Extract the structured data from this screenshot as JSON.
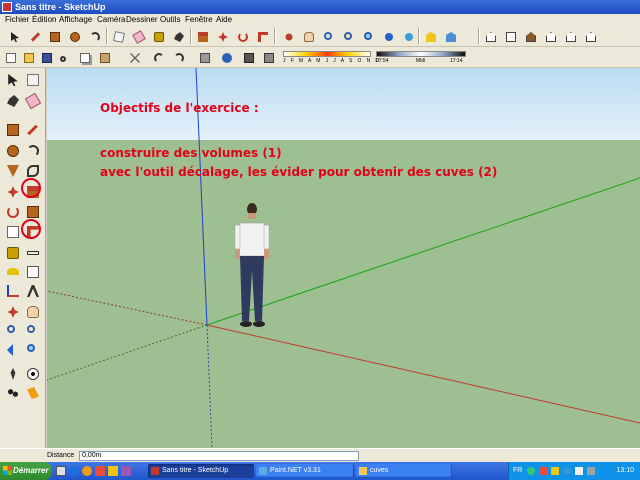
{
  "window": {
    "title": "Sans titre - SketchUp"
  },
  "menu": [
    "Fichier",
    "Édition",
    "Affichage",
    "Caméra",
    "Dessiner",
    "Outils",
    "Fenêtre",
    "Aide"
  ],
  "toolbar": {
    "shadow_months": "J F M A M J J A S O N D",
    "shadow_time_start": "07:54",
    "shadow_time_mid": "Midi",
    "shadow_time_end": "17:14"
  },
  "overlay": {
    "line1": "Objectifs de l'exercice :",
    "line2": "construire des volumes (1)",
    "line3": "avec l'outil décalage, les évider pour obtenir des cuves (2)"
  },
  "annotations": [
    "1",
    "2"
  ],
  "status": {
    "label": "Distance",
    "value": "0,00m"
  },
  "taskbar": {
    "start": "Démarrer",
    "tasks": [
      "Sans titre - SketchUp",
      "Paint.NET v3.31",
      "cuves"
    ],
    "lang": "FR",
    "time": "13:10"
  },
  "colors": {
    "annotation": "#e4001b",
    "sky": "#b9dcf2",
    "ground": "#9dbf91",
    "axis_red": "#c0392b",
    "axis_green": "#1aa31a",
    "axis_blue": "#1e40c8"
  }
}
